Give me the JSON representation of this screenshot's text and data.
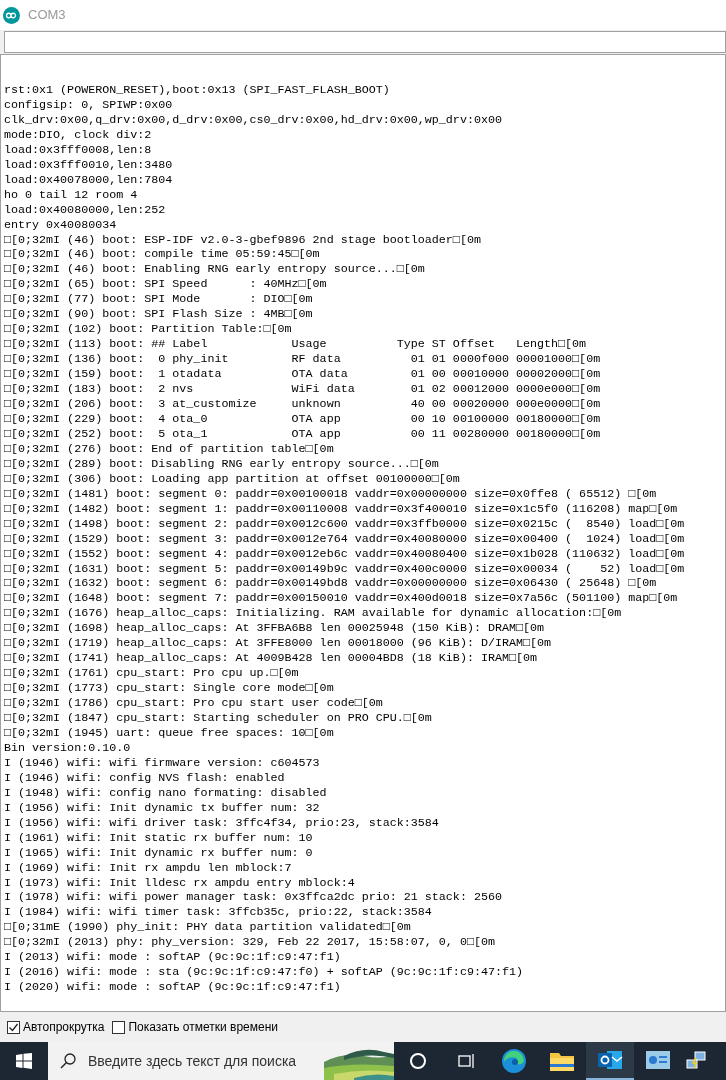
{
  "window": {
    "title": "COM3"
  },
  "serial_output": {
    "lines": [
      "rst:0x1 (POWERON_RESET),boot:0x13 (SPI_FAST_FLASH_BOOT)",
      "configsip: 0, SPIWP:0x00",
      "clk_drv:0x00,q_drv:0x00,d_drv:0x00,cs0_drv:0x00,hd_drv:0x00,wp_drv:0x00",
      "mode:DIO, clock div:2",
      "load:0x3fff0008,len:8",
      "load:0x3fff0010,len:3480",
      "load:0x40078000,len:7804",
      "ho 0 tail 12 room 4",
      "load:0x40080000,len:252",
      "entry 0x40080034",
      "□[0;32mI (46) boot: ESP-IDF v2.0-3-gbef9896 2nd stage bootloader□[0m",
      "□[0;32mI (46) boot: compile time 05:59:45□[0m",
      "□[0;32mI (46) boot: Enabling RNG early entropy source...□[0m",
      "□[0;32mI (65) boot: SPI Speed      : 40MHz□[0m",
      "□[0;32mI (77) boot: SPI Mode       : DIO□[0m",
      "□[0;32mI (90) boot: SPI Flash Size : 4MB□[0m",
      "□[0;32mI (102) boot: Partition Table:□[0m",
      "□[0;32mI (113) boot: ## Label            Usage          Type ST Offset   Length□[0m",
      "□[0;32mI (136) boot:  0 phy_init         RF data          01 01 0000f000 00001000□[0m",
      "□[0;32mI (159) boot:  1 otadata          OTA data         01 00 00010000 00002000□[0m",
      "□[0;32mI (183) boot:  2 nvs              WiFi data        01 02 00012000 0000e000□[0m",
      "□[0;32mI (206) boot:  3 at_customize     unknown          40 00 00020000 000e0000□[0m",
      "□[0;32mI (229) boot:  4 ota_0            OTA app          00 10 00100000 00180000□[0m",
      "□[0;32mI (252) boot:  5 ota_1            OTA app          00 11 00280000 00180000□[0m",
      "□[0;32mI (276) boot: End of partition table□[0m",
      "□[0;32mI (289) boot: Disabling RNG early entropy source...□[0m",
      "□[0;32mI (306) boot: Loading app partition at offset 00100000□[0m",
      "□[0;32mI (1481) boot: segment 0: paddr=0x00100018 vaddr=0x00000000 size=0x0ffe8 ( 65512) □[0m",
      "□[0;32mI (1482) boot: segment 1: paddr=0x00110008 vaddr=0x3f400010 size=0x1c5f0 (116208) map□[0m",
      "□[0;32mI (1498) boot: segment 2: paddr=0x0012c600 vaddr=0x3ffb0000 size=0x0215c (  8540) load□[0m",
      "□[0;32mI (1529) boot: segment 3: paddr=0x0012e764 vaddr=0x40080000 size=0x00400 (  1024) load□[0m",
      "□[0;32mI (1552) boot: segment 4: paddr=0x0012eb6c vaddr=0x40080400 size=0x1b028 (110632) load□[0m",
      "□[0;32mI (1631) boot: segment 5: paddr=0x00149b9c vaddr=0x400c0000 size=0x00034 (    52) load□[0m",
      "□[0;32mI (1632) boot: segment 6: paddr=0x00149bd8 vaddr=0x00000000 size=0x06430 ( 25648) □[0m",
      "□[0;32mI (1648) boot: segment 7: paddr=0x00150010 vaddr=0x400d0018 size=0x7a56c (501100) map□[0m",
      "□[0;32mI (1676) heap_alloc_caps: Initializing. RAM available for dynamic allocation:□[0m",
      "□[0;32mI (1698) heap_alloc_caps: At 3FFBA6B8 len 00025948 (150 KiB): DRAM□[0m",
      "□[0;32mI (1719) heap_alloc_caps: At 3FFE8000 len 00018000 (96 KiB): D/IRAM□[0m",
      "□[0;32mI (1741) heap_alloc_caps: At 4009B428 len 00004BD8 (18 KiB): IRAM□[0m",
      "□[0;32mI (1761) cpu_start: Pro cpu up.□[0m",
      "□[0;32mI (1773) cpu_start: Single core mode□[0m",
      "□[0;32mI (1786) cpu_start: Pro cpu start user code□[0m",
      "□[0;32mI (1847) cpu_start: Starting scheduler on PRO CPU.□[0m",
      "□[0;32mI (1945) uart: queue free spaces: 10□[0m",
      "Bin version:0.10.0",
      "I (1946) wifi: wifi firmware version: c604573",
      "I (1946) wifi: config NVS flash: enabled",
      "I (1948) wifi: config nano formating: disabled",
      "I (1956) wifi: Init dynamic tx buffer num: 32",
      "I (1956) wifi: wifi driver task: 3ffc4f34, prio:23, stack:3584",
      "I (1961) wifi: Init static rx buffer num: 10",
      "I (1965) wifi: Init dynamic rx buffer num: 0",
      "I (1969) wifi: Init rx ampdu len mblock:7",
      "I (1973) wifi: Init lldesc rx ampdu entry mblock:4",
      "I (1978) wifi: wifi power manager task: 0x3ffca2dc prio: 21 stack: 2560",
      "I (1984) wifi: wifi timer task: 3ffcb35c, prio:22, stack:3584",
      "□[0;31mE (1990) phy_init: PHY data partition validated□[0m",
      "□[0;32mI (2013) phy: phy_version: 329, Feb 22 2017, 15:58:07, 0, 0□[0m",
      "I (2013) wifi: mode : softAP (9c:9c:1f:c9:47:f1)",
      "I (2016) wifi: mode : sta (9c:9c:1f:c9:47:f0) + softAP (9c:9c:1f:c9:47:f1)",
      "I (2020) wifi: mode : softAP (9c:9c:1f:c9:47:f1)"
    ]
  },
  "options": [
    {
      "label": "Автопрокрутка",
      "checked": true
    },
    {
      "label": "Показать отметки времени",
      "checked": false
    }
  ],
  "taskbar": {
    "search": {
      "placeholder": "Введите здесь текст для поиска"
    },
    "apps": [
      {
        "kind": "cortana",
        "selected": false
      },
      {
        "kind": "taskview",
        "selected": false
      },
      {
        "kind": "edge",
        "selected": false
      },
      {
        "kind": "folder",
        "selected": false
      },
      {
        "kind": "outlook",
        "selected": true
      },
      {
        "kind": "app",
        "selected": false
      }
    ]
  }
}
